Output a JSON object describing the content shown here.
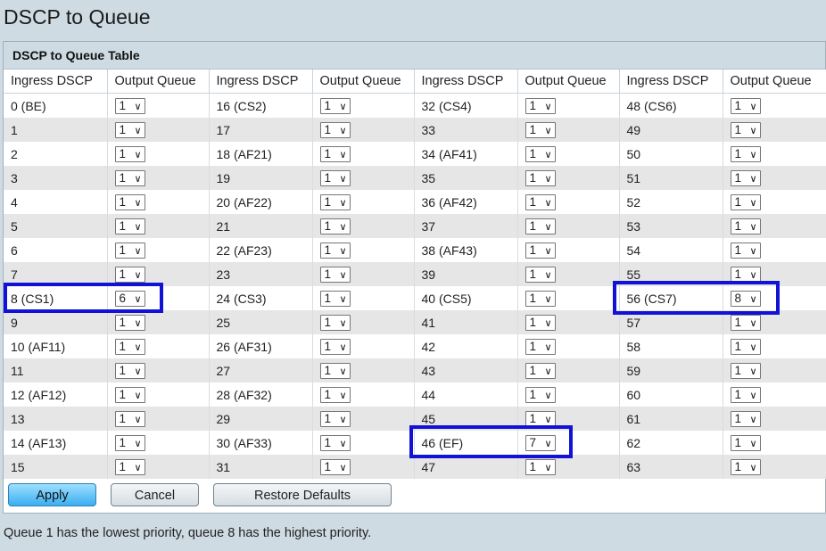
{
  "page": {
    "title": "DSCP to Queue"
  },
  "table": {
    "title": "DSCP to Queue Table",
    "headers": [
      "Ingress DSCP",
      "Output Queue",
      "Ingress DSCP",
      "Output Queue",
      "Ingress DSCP",
      "Output Queue",
      "Ingress DSCP",
      "Output Queue"
    ],
    "rows": [
      [
        {
          "dscp": "0 (BE)",
          "queue": "1"
        },
        {
          "dscp": "16 (CS2)",
          "queue": "1"
        },
        {
          "dscp": "32 (CS4)",
          "queue": "1"
        },
        {
          "dscp": "48 (CS6)",
          "queue": "1"
        }
      ],
      [
        {
          "dscp": "1",
          "queue": "1"
        },
        {
          "dscp": "17",
          "queue": "1"
        },
        {
          "dscp": "33",
          "queue": "1"
        },
        {
          "dscp": "49",
          "queue": "1"
        }
      ],
      [
        {
          "dscp": "2",
          "queue": "1"
        },
        {
          "dscp": "18 (AF21)",
          "queue": "1"
        },
        {
          "dscp": "34 (AF41)",
          "queue": "1"
        },
        {
          "dscp": "50",
          "queue": "1"
        }
      ],
      [
        {
          "dscp": "3",
          "queue": "1"
        },
        {
          "dscp": "19",
          "queue": "1"
        },
        {
          "dscp": "35",
          "queue": "1"
        },
        {
          "dscp": "51",
          "queue": "1"
        }
      ],
      [
        {
          "dscp": "4",
          "queue": "1"
        },
        {
          "dscp": "20 (AF22)",
          "queue": "1"
        },
        {
          "dscp": "36 (AF42)",
          "queue": "1"
        },
        {
          "dscp": "52",
          "queue": "1"
        }
      ],
      [
        {
          "dscp": "5",
          "queue": "1"
        },
        {
          "dscp": "21",
          "queue": "1"
        },
        {
          "dscp": "37",
          "queue": "1"
        },
        {
          "dscp": "53",
          "queue": "1"
        }
      ],
      [
        {
          "dscp": "6",
          "queue": "1"
        },
        {
          "dscp": "22 (AF23)",
          "queue": "1"
        },
        {
          "dscp": "38 (AF43)",
          "queue": "1"
        },
        {
          "dscp": "54",
          "queue": "1"
        }
      ],
      [
        {
          "dscp": "7",
          "queue": "1"
        },
        {
          "dscp": "23",
          "queue": "1"
        },
        {
          "dscp": "39",
          "queue": "1"
        },
        {
          "dscp": "55",
          "queue": "1"
        }
      ],
      [
        {
          "dscp": "8 (CS1)",
          "queue": "6"
        },
        {
          "dscp": "24 (CS3)",
          "queue": "1"
        },
        {
          "dscp": "40 (CS5)",
          "queue": "1"
        },
        {
          "dscp": "56 (CS7)",
          "queue": "8"
        }
      ],
      [
        {
          "dscp": "9",
          "queue": "1"
        },
        {
          "dscp": "25",
          "queue": "1"
        },
        {
          "dscp": "41",
          "queue": "1"
        },
        {
          "dscp": "57",
          "queue": "1"
        }
      ],
      [
        {
          "dscp": "10 (AF11)",
          "queue": "1"
        },
        {
          "dscp": "26 (AF31)",
          "queue": "1"
        },
        {
          "dscp": "42",
          "queue": "1"
        },
        {
          "dscp": "58",
          "queue": "1"
        }
      ],
      [
        {
          "dscp": "11",
          "queue": "1"
        },
        {
          "dscp": "27",
          "queue": "1"
        },
        {
          "dscp": "43",
          "queue": "1"
        },
        {
          "dscp": "59",
          "queue": "1"
        }
      ],
      [
        {
          "dscp": "12 (AF12)",
          "queue": "1"
        },
        {
          "dscp": "28 (AF32)",
          "queue": "1"
        },
        {
          "dscp": "44",
          "queue": "1"
        },
        {
          "dscp": "60",
          "queue": "1"
        }
      ],
      [
        {
          "dscp": "13",
          "queue": "1"
        },
        {
          "dscp": "29",
          "queue": "1"
        },
        {
          "dscp": "45",
          "queue": "1"
        },
        {
          "dscp": "61",
          "queue": "1"
        }
      ],
      [
        {
          "dscp": "14 (AF13)",
          "queue": "1"
        },
        {
          "dscp": "30 (AF33)",
          "queue": "1"
        },
        {
          "dscp": "46 (EF)",
          "queue": "7"
        },
        {
          "dscp": "62",
          "queue": "1"
        }
      ],
      [
        {
          "dscp": "15",
          "queue": "1"
        },
        {
          "dscp": "31",
          "queue": "1"
        },
        {
          "dscp": "47",
          "queue": "1"
        },
        {
          "dscp": "63",
          "queue": "1"
        }
      ]
    ]
  },
  "buttons": {
    "apply": "Apply",
    "cancel": "Cancel",
    "restore": "Restore Defaults"
  },
  "footer": {
    "note": "Queue 1 has the lowest priority, queue 8 has the highest priority."
  },
  "icons": {
    "select_arrow": "chevron-down-icon"
  },
  "colors": {
    "highlight": "#1212d6",
    "apply_button": "#39aef0"
  }
}
